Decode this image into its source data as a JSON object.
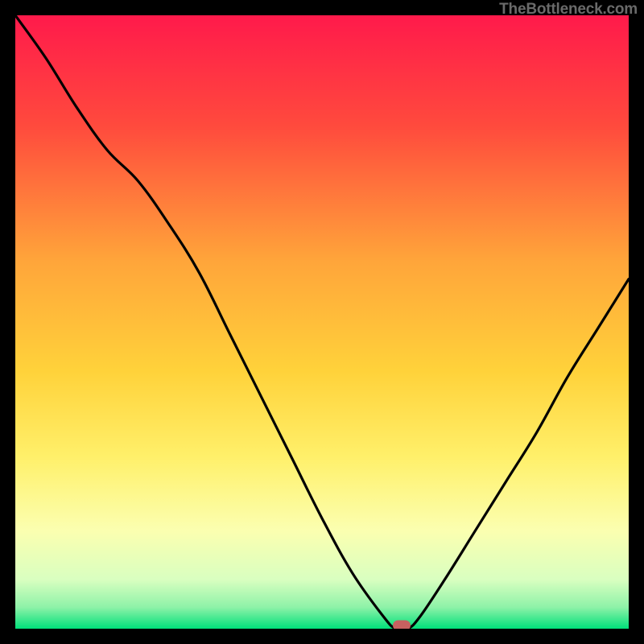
{
  "attribution": "TheBottleneck.com",
  "colors": {
    "top": "#ff1a4b",
    "mid_upper": "#ff7a3a",
    "mid": "#ffd23a",
    "mid_lower": "#fff56a",
    "lower": "#f3ffa8",
    "green_light": "#b6f7c1",
    "green": "#00e07a",
    "marker": "#c76160",
    "curve": "#000000",
    "background": "#000000"
  },
  "chart_data": {
    "type": "line",
    "title": "",
    "xlabel": "",
    "ylabel": "",
    "xlim": [
      0,
      100
    ],
    "ylim": [
      0,
      100
    ],
    "grid": false,
    "legend": false,
    "series": [
      {
        "name": "bottleneck-curve",
        "x": [
          0,
          5,
          10,
          15,
          20,
          25,
          30,
          35,
          40,
          45,
          50,
          55,
          60,
          62,
          64,
          66,
          70,
          75,
          80,
          85,
          90,
          95,
          100
        ],
        "values": [
          100,
          93,
          85,
          78,
          73,
          66,
          58,
          48,
          38,
          28,
          18,
          9,
          2,
          0,
          0,
          2,
          8,
          16,
          24,
          32,
          41,
          49,
          57
        ]
      }
    ],
    "annotations": [
      {
        "name": "optimal-marker",
        "x": 63,
        "y": 0.5
      }
    ],
    "background_gradient_stops": [
      {
        "pos": 0.0,
        "color": "#ff1a4b"
      },
      {
        "pos": 0.18,
        "color": "#ff4a3d"
      },
      {
        "pos": 0.4,
        "color": "#ffa53a"
      },
      {
        "pos": 0.58,
        "color": "#ffd23a"
      },
      {
        "pos": 0.72,
        "color": "#fff06a"
      },
      {
        "pos": 0.84,
        "color": "#fbffb0"
      },
      {
        "pos": 0.92,
        "color": "#d9ffc0"
      },
      {
        "pos": 0.965,
        "color": "#8ef2a8"
      },
      {
        "pos": 1.0,
        "color": "#00e07a"
      }
    ]
  }
}
